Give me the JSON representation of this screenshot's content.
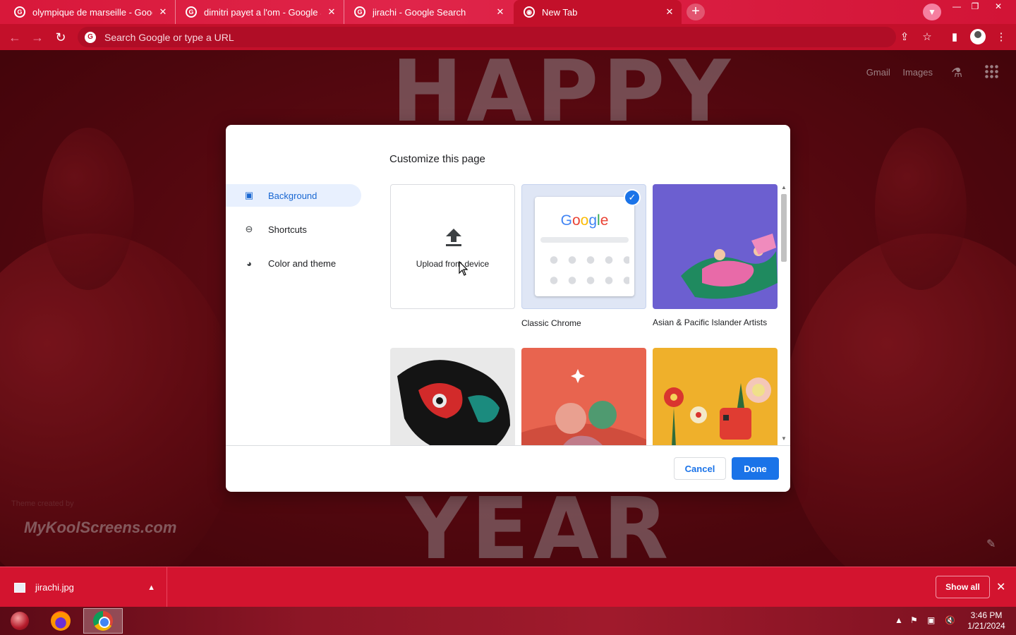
{
  "browser": {
    "tabs": [
      {
        "title": "olympique de marseille - Google",
        "active": false
      },
      {
        "title": "dimitri payet a l'om - Google Se",
        "active": false
      },
      {
        "title": "jirachi - Google Search",
        "active": false
      },
      {
        "title": "New Tab",
        "active": true
      }
    ],
    "omnibox_placeholder": "Search Google or type a URL"
  },
  "ntp": {
    "links": [
      "Gmail",
      "Images"
    ],
    "background_words": [
      "HAPPY",
      "YEAR"
    ],
    "watermark": "MyKoolScreens.com",
    "watermark_small": "Theme created by"
  },
  "dialog": {
    "title": "Customize this page",
    "menu": [
      {
        "label": "Background",
        "icon": "image-icon",
        "selected": true
      },
      {
        "label": "Shortcuts",
        "icon": "link-icon",
        "selected": false
      },
      {
        "label": "Color and theme",
        "icon": "palette-icon",
        "selected": false
      }
    ],
    "tiles": [
      {
        "label": "Upload from device",
        "kind": "upload"
      },
      {
        "label": "Classic Chrome",
        "kind": "classic",
        "selected": true
      },
      {
        "label": "Asian & Pacific Islander Artists",
        "kind": "collection"
      },
      {
        "label": "",
        "kind": "collection"
      },
      {
        "label": "",
        "kind": "collection"
      },
      {
        "label": "",
        "kind": "collection"
      }
    ],
    "classic_logo": "Google",
    "cancel_label": "Cancel",
    "done_label": "Done"
  },
  "downloads": {
    "file_name": "jirachi.jpg",
    "show_all_label": "Show all"
  },
  "taskbar": {
    "time": "3:46 PM",
    "date": "1/21/2024"
  }
}
